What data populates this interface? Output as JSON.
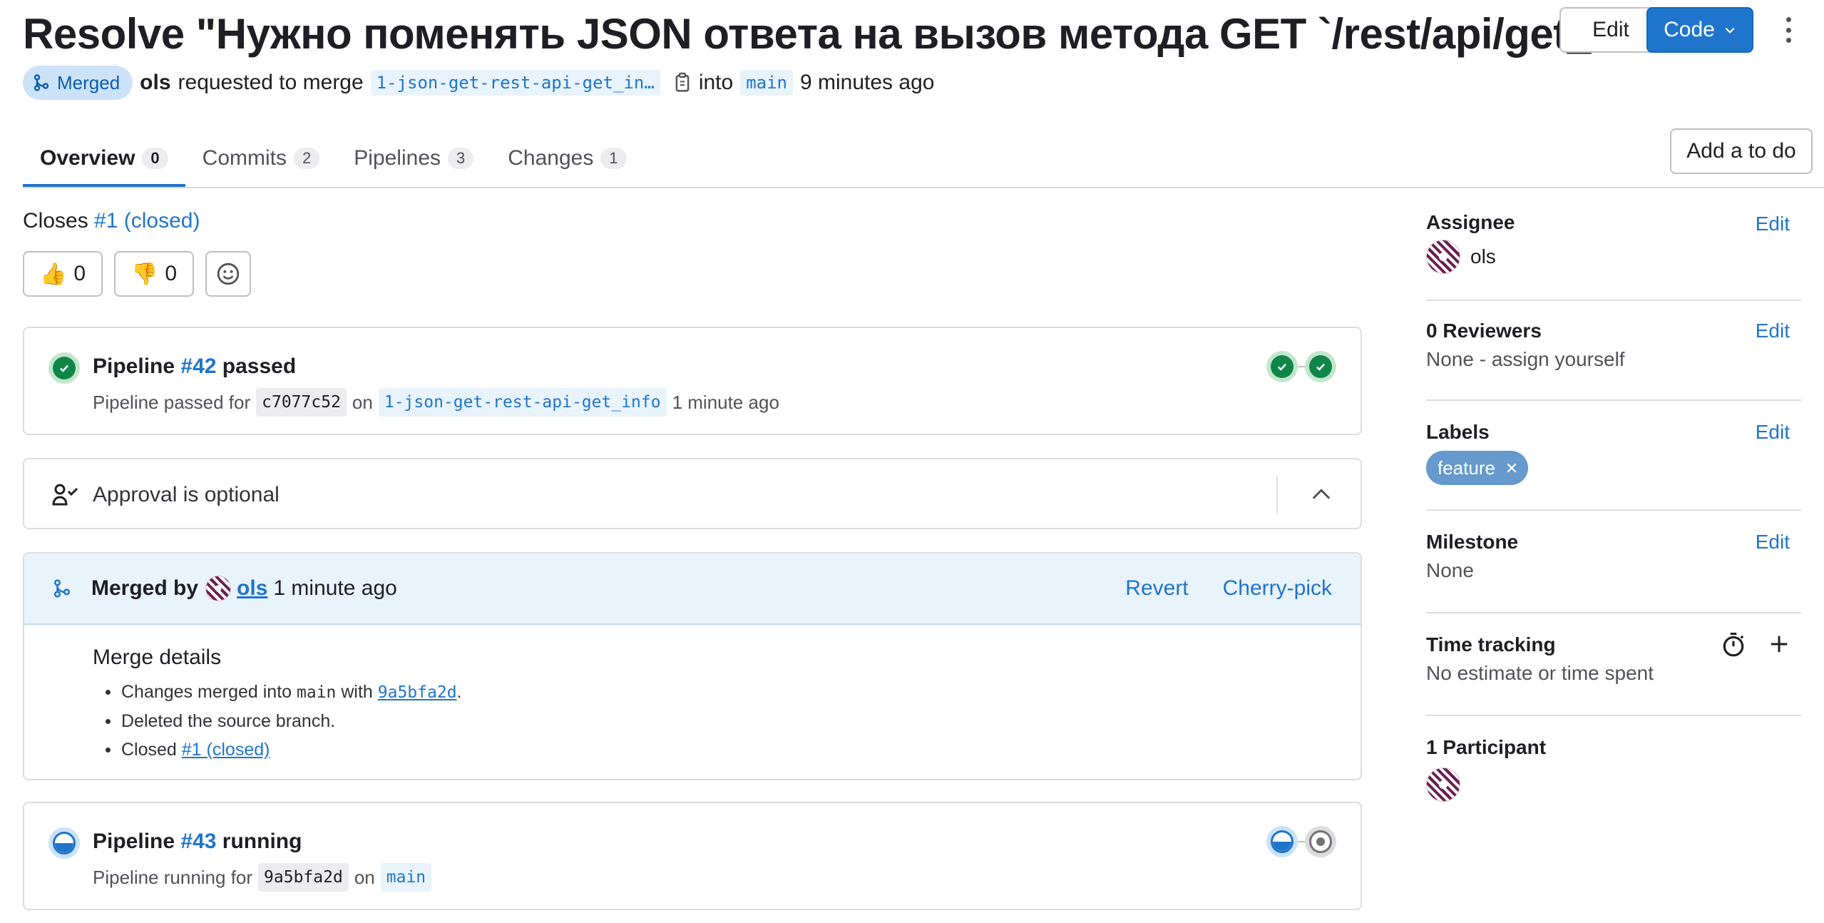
{
  "header": {
    "title": "Resolve \"Нужно поменять JSON ответа на вызов метода GET `/rest/api/get_info`\"",
    "edit_label": "Edit",
    "code_label": "Code"
  },
  "meta": {
    "status_badge": "Merged",
    "author": "ols",
    "requested_text": "requested to merge",
    "source_branch": "1-json-get-rest-api-get_in…",
    "into_text": "into",
    "target_branch": "main",
    "time_ago": "9 minutes ago"
  },
  "tabs": [
    {
      "label": "Overview",
      "count": "0"
    },
    {
      "label": "Commits",
      "count": "2"
    },
    {
      "label": "Pipelines",
      "count": "3"
    },
    {
      "label": "Changes",
      "count": "1"
    }
  ],
  "add_todo_label": "Add a to do",
  "closes": {
    "prefix": "Closes",
    "issue": "#1 (closed)"
  },
  "reactions": {
    "thumbsup": "0",
    "thumbsdown": "0"
  },
  "pipeline1": {
    "prefix": "Pipeline",
    "id": "#42",
    "status": "passed",
    "sub_prefix": "Pipeline passed for",
    "commit": "c7077c52",
    "on": "on",
    "branch": "1-json-get-rest-api-get_info",
    "time": "1 minute ago"
  },
  "approval": {
    "text": "Approval is optional"
  },
  "merged": {
    "prefix": "Merged by",
    "user": "ols",
    "time": "1 minute ago",
    "revert": "Revert",
    "cherry_pick": "Cherry-pick",
    "details_title": "Merge details",
    "d1_prefix": "Changes merged into",
    "d1_branch": "main",
    "d1_with": "with",
    "d1_commit": "9a5bfa2d",
    "d1_end": ".",
    "d2": "Deleted the source branch.",
    "d3_prefix": "Closed",
    "d3_link": "#1 (closed)"
  },
  "pipeline2": {
    "prefix": "Pipeline",
    "id": "#43",
    "status": "running",
    "sub_prefix": "Pipeline running for",
    "commit": "9a5bfa2d",
    "on": "on",
    "branch": "main"
  },
  "sidebar": {
    "assignee": {
      "title": "Assignee",
      "edit": "Edit",
      "value": "ols"
    },
    "reviewers": {
      "title": "0 Reviewers",
      "edit": "Edit",
      "value": "None - assign yourself"
    },
    "labels": {
      "title": "Labels",
      "edit": "Edit",
      "label": "feature",
      "label_color": "#6699cc"
    },
    "milestone": {
      "title": "Milestone",
      "edit": "Edit",
      "value": "None"
    },
    "time_tracking": {
      "title": "Time tracking",
      "value": "No estimate or time spent"
    },
    "participants": {
      "title": "1 Participant"
    }
  },
  "colors": {
    "accent": "#1f75cb",
    "success": "#108548",
    "merged_badge_bg": "#cbe2f9"
  }
}
